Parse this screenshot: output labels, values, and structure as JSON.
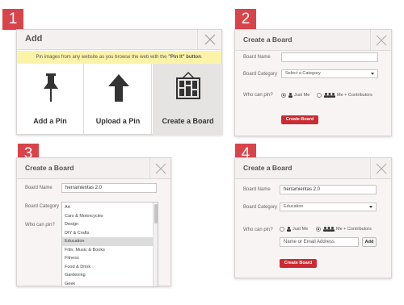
{
  "badges": [
    "1",
    "2",
    "3",
    "4"
  ],
  "panel1": {
    "title": "Add",
    "banner_prefix": "Pin images from any website as you browse the web with the ",
    "banner_strong": "\"Pin It\" button",
    "banner_suffix": ".",
    "options": [
      {
        "label": "Add a Pin",
        "icon": "pushpin-icon"
      },
      {
        "label": "Upload a Pin",
        "icon": "upload-arrow-icon"
      },
      {
        "label": "Create a Board",
        "icon": "board-frame-icon"
      }
    ]
  },
  "panel2": {
    "title": "Create a Board",
    "board_name_label": "Board Name",
    "board_name_value": "",
    "category_label": "Board Category",
    "category_value": "Select a Category",
    "who_label": "Who can pin?",
    "just_me": "Just Me",
    "contributors": "Me + Contributors",
    "create_button": "Create Board"
  },
  "panel3": {
    "title": "Create a Board",
    "board_name_label": "Board Name",
    "board_name_value": "herramientas 2.0",
    "category_label": "Board Category",
    "who_label": "Who can pin?",
    "dropdown_items": [
      "Art",
      "Cars & Motorcycles",
      "Design",
      "DIY & Crafts",
      "Education",
      "Film, Music & Books",
      "Fitness",
      "Food & Drink",
      "Gardening",
      "Geek"
    ],
    "highlighted_item": "Education"
  },
  "panel4": {
    "title": "Create a Board",
    "board_name_label": "Board Name",
    "board_name_value": "herramientas 2.0",
    "category_label": "Board Category",
    "category_value": "Education",
    "who_label": "Who can pin?",
    "just_me": "Just Me",
    "contributors": "Me + Contributors",
    "contributor_placeholder": "Name or Email Address",
    "add_button": "Add",
    "create_button": "Create Board"
  },
  "colors": {
    "accent_red": "#cc2b33",
    "badge_red": "#d9444a",
    "banner_yellow": "#fbf3a8"
  }
}
